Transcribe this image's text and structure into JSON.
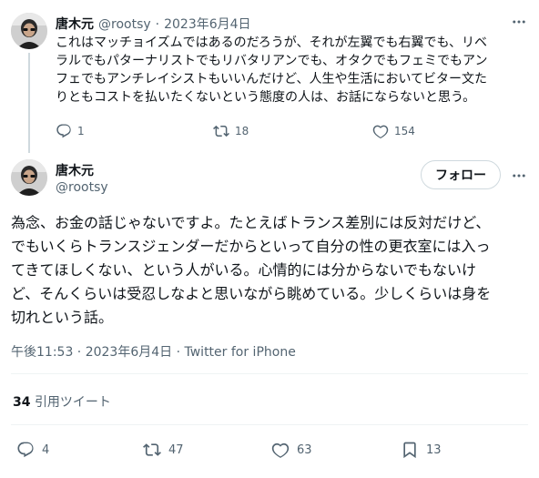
{
  "reply": {
    "author_name": "唐木元",
    "handle": "@rootsy",
    "separator": "·",
    "date": "2023年6月4日",
    "text_lines": [
      "これはマッチョイズムではあるのだろうが、それが左翼でも右翼でも、リベ",
      "ラルでもパターナリストでもリバタリアンでも、オタクでもフェミでもアン",
      "フェでもアンチレイシストもいいんだけど、人生や生活においてビター文た",
      "りともコストを払いたくないという態度の人は、お話にならないと思う。"
    ],
    "replies_count": "1",
    "retweets_count": "18",
    "likes_count": "154"
  },
  "main": {
    "author_name": "唐木元",
    "handle": "@rootsy",
    "follow_label": "フォロー",
    "text_lines": [
      "為念、お金の話じゃないですよ。たとえばトランス差別には反対だけど、",
      "でもいくらトランスジェンダーだからといって自分の性の更衣室には入っ",
      "てきてほしくない、という人がいる。心情的には分からないでもないけ",
      "ど、そんくらいは受忍しなよと思いながら眺めている。少しくらいは身を",
      "切れという話。"
    ],
    "meta": "午後11:53 · 2023年6月4日 · Twitter for iPhone",
    "quote_count": "34",
    "quote_label": "引用ツイート",
    "replies_count": "4",
    "retweets_count": "47",
    "likes_count": "63",
    "bookmarks_count": "13"
  }
}
